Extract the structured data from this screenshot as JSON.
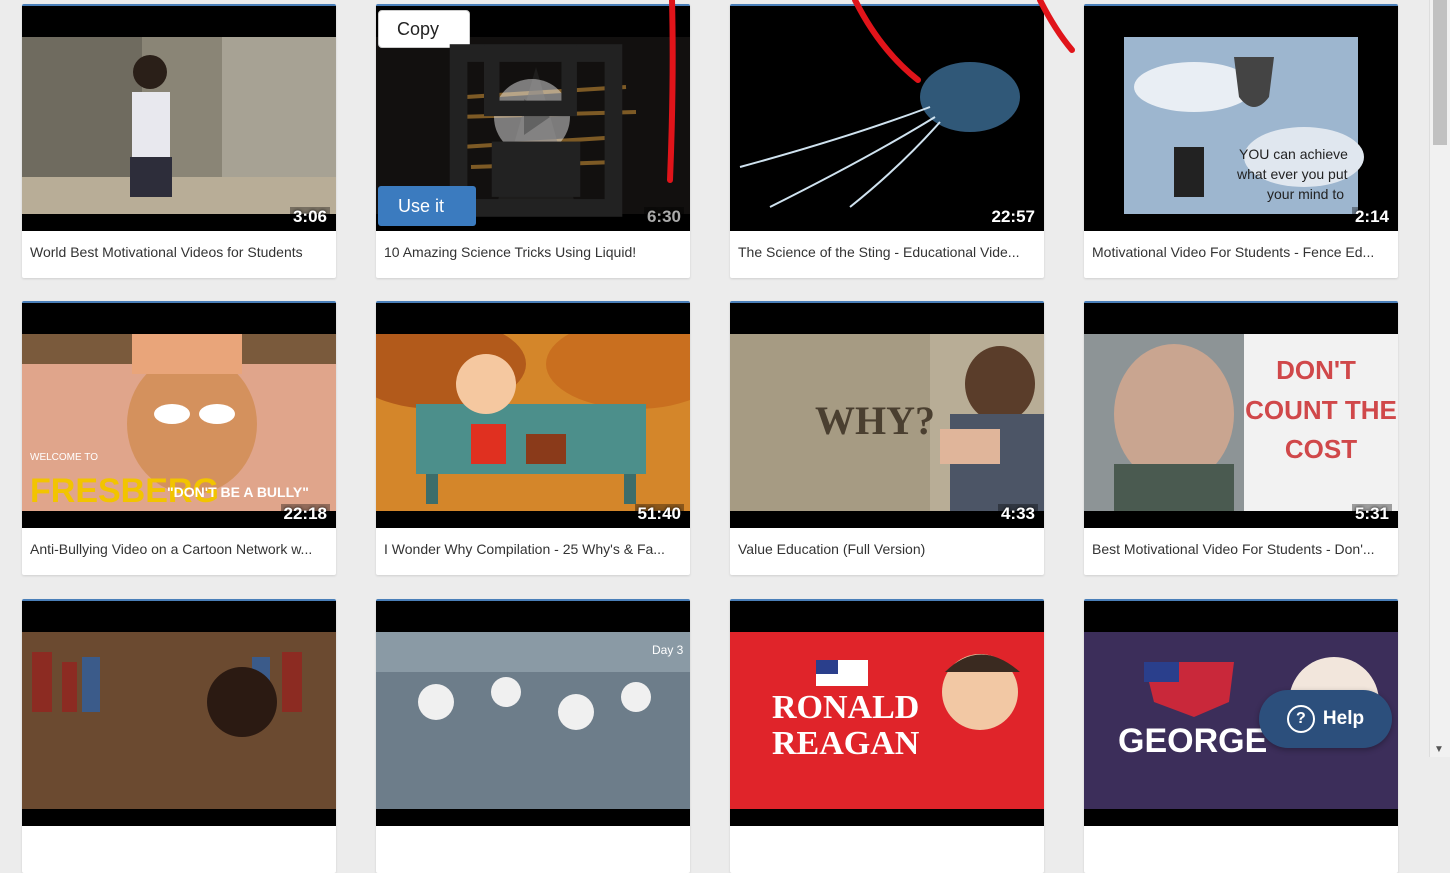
{
  "videos": [
    {
      "title": "World Best Motivational Videos for Students",
      "duration": "3:06"
    },
    {
      "title": "10 Amazing Science Tricks Using Liquid!",
      "duration": "6:30"
    },
    {
      "title": "The Science of the Sting - Educational Vide...",
      "duration": "22:57"
    },
    {
      "title": "Motivational Video For Students - Fence Ed...",
      "duration": "2:14",
      "thumb_text": [
        "YOU can achieve",
        "what ever you put",
        "your mind to"
      ]
    },
    {
      "title": "Anti-Bullying Video on a Cartoon Network w...",
      "duration": "22:18",
      "thumb_text": [
        "WELCOME TO",
        "FRESBERG",
        "\"DON'T BE A BULLY\""
      ]
    },
    {
      "title": "I Wonder Why Compilation - 25 Why's & Fa...",
      "duration": "51:40"
    },
    {
      "title": "Value Education (Full Version)",
      "duration": "4:33",
      "thumb_text": [
        "WHY?"
      ]
    },
    {
      "title": "Best Motivational Video For Students - Don'...",
      "duration": "5:31",
      "thumb_text": [
        "DON'T",
        "COUNT THE",
        "COST"
      ]
    },
    {
      "title": "",
      "duration": ""
    },
    {
      "title": "",
      "duration": "",
      "thumb_text": [
        "Day 3"
      ]
    },
    {
      "title": "",
      "duration": "",
      "thumb_text": [
        "RONALD",
        "REAGAN"
      ]
    },
    {
      "title": "",
      "duration": "",
      "thumb_text": [
        "GEORGE"
      ]
    }
  ],
  "hover_actions": {
    "copy_label": "Copy",
    "use_label": "Use it"
  },
  "help": {
    "label": "Help"
  },
  "colors": {
    "accent": "#3b7bbf",
    "help_bg": "#2c4f7c",
    "card_border": "#4a7fb9"
  }
}
